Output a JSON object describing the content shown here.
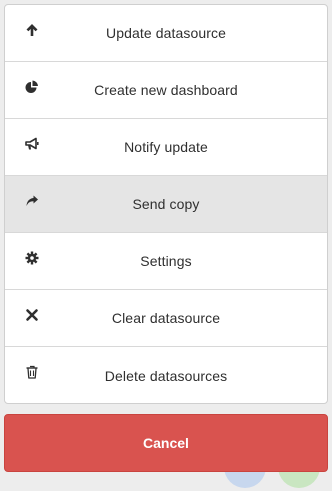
{
  "menu": {
    "items": [
      {
        "label": "Update datasource",
        "icon": "arrow-up-icon"
      },
      {
        "label": "Create new dashboard",
        "icon": "pie-chart-icon"
      },
      {
        "label": "Notify update",
        "icon": "bullhorn-icon"
      },
      {
        "label": "Send copy",
        "icon": "share-arrow-icon",
        "highlighted": true
      },
      {
        "label": "Settings",
        "icon": "gear-icon"
      },
      {
        "label": "Clear datasource",
        "icon": "close-icon"
      },
      {
        "label": "Delete datasources",
        "icon": "trash-icon"
      }
    ]
  },
  "cancel": {
    "label": "Cancel"
  },
  "colors": {
    "cancel_bg": "#d9534f",
    "highlight_bg": "#e5e5e5",
    "text": "#2f2f2f"
  }
}
